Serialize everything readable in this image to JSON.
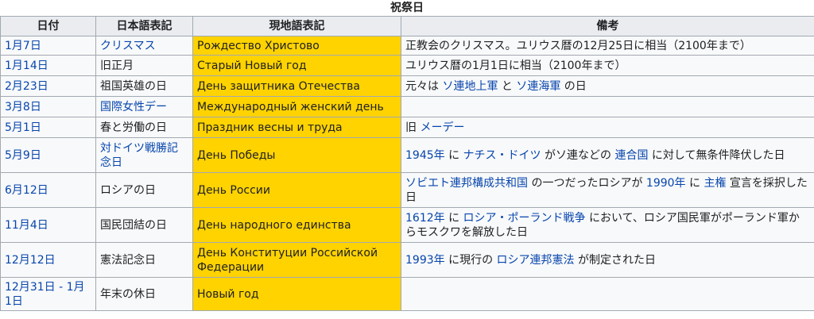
{
  "caption": "祝祭日",
  "headers": [
    "日付",
    "日本語表記",
    "現地語表記",
    "備考"
  ],
  "rows": [
    {
      "date": "1月7日",
      "ja": "クリスマス",
      "ru": "Рождество Христово",
      "note": [
        {
          "t": "正教会のクリスマス。ユリウス暦の12月25日に相当（2100年まで）",
          "link": false
        }
      ]
    },
    {
      "date": "1月14日",
      "ja": "旧正月",
      "ru": "Старый Новый год",
      "note": [
        {
          "t": "ユリウス暦の1月1日に相当（2100年まで）",
          "link": false
        }
      ]
    },
    {
      "date": "2月23日",
      "ja": "祖国英雄の日",
      "ru": "День защитника Отечества",
      "note": [
        {
          "t": "元々は ",
          "link": false
        },
        {
          "t": "ソ連地上軍",
          "link": true
        },
        {
          "t": " と ",
          "link": false
        },
        {
          "t": "ソ連海軍",
          "link": true
        },
        {
          "t": " の日",
          "link": false
        }
      ]
    },
    {
      "date": "3月8日",
      "ja": "国際女性デー",
      "ru": "Международный женский день",
      "note": []
    },
    {
      "date": "5月1日",
      "ja": "春と労働の日",
      "ru": "Праздник весны и труда",
      "note": [
        {
          "t": "旧 ",
          "link": false
        },
        {
          "t": "メーデー",
          "link": true
        }
      ]
    },
    {
      "date": "5月9日",
      "ja": "対ドイツ戦勝記念日",
      "ru": "День Победы",
      "note": [
        {
          "t": "1945年",
          "link": true
        },
        {
          "t": " に ",
          "link": false
        },
        {
          "t": "ナチス・ドイツ",
          "link": true
        },
        {
          "t": " がソ連などの ",
          "link": false
        },
        {
          "t": "連合国",
          "link": true
        },
        {
          "t": " に対して無条件降伏した日",
          "link": false
        }
      ]
    },
    {
      "date": "6月12日",
      "ja": "ロシアの日",
      "ru": "День России",
      "note": [
        {
          "t": "ソビエト連邦構成共和国",
          "link": true
        },
        {
          "t": " の一つだったロシアが ",
          "link": false
        },
        {
          "t": "1990年",
          "link": true
        },
        {
          "t": " に ",
          "link": false
        },
        {
          "t": "主権",
          "link": true
        },
        {
          "t": " 宣言を採択した日",
          "link": false
        }
      ]
    },
    {
      "date": "11月4日",
      "ja": "国民団結の日",
      "ru": "День народного единства",
      "note": [
        {
          "t": "1612年",
          "link": true
        },
        {
          "t": " に ",
          "link": false
        },
        {
          "t": "ロシア・ポーランド戦争",
          "link": true
        },
        {
          "t": " において、ロシア国民軍がポーランド軍からモスクワを解放した日",
          "link": false
        }
      ]
    },
    {
      "date": "12月12日",
      "ja": "憲法記念日",
      "ru": "День Конституции Российской Федерации",
      "note": [
        {
          "t": "1993年",
          "link": true
        },
        {
          "t": " に現行の ",
          "link": false
        },
        {
          "t": "ロシア連邦憲法",
          "link": true
        },
        {
          "t": " が制定された日",
          "link": false
        }
      ]
    },
    {
      "date": "12月31日 - 1月1日",
      "ja": "年末の休日",
      "ru": "Новый год",
      "note": []
    }
  ],
  "links": {
    "date_linked": true,
    "ja_linked_rows": [
      0,
      3
    ]
  }
}
